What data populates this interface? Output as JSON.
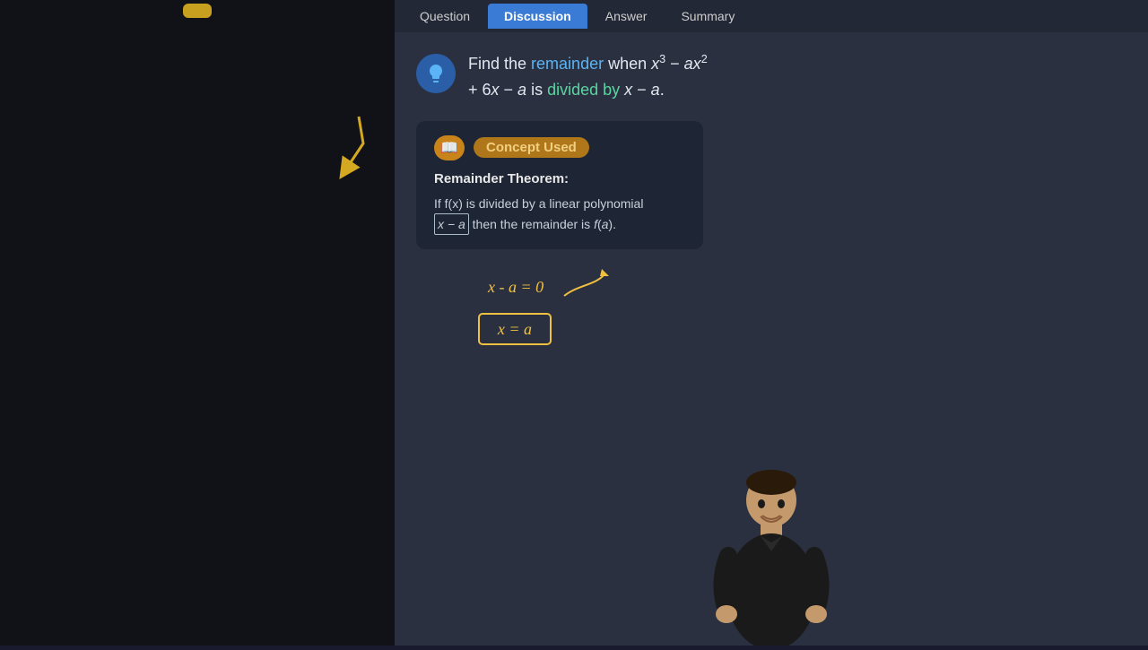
{
  "tabs": [
    {
      "label": "Question",
      "active": false
    },
    {
      "label": "Discussion",
      "active": true
    },
    {
      "label": "Answer",
      "active": false
    },
    {
      "label": "Summary",
      "active": false
    }
  ],
  "question": {
    "text_prefix": "Find the ",
    "highlight1": "remainder",
    "text_middle": " when ",
    "equation1": "x³ − ax²",
    "equation2": "+ 6x − a",
    "text_before_divisor": " is ",
    "highlight2": "divided by",
    "divisor": " x − a."
  },
  "concept": {
    "label": "Concept Used",
    "theorem_title": "Remainder Theorem:",
    "theorem_body_1": "If f(x) is divided by a linear polynomial",
    "theorem_boxed": "x − a",
    "theorem_body_2": "then the remainder is f(a).",
    "annotation_line1": "x - a = 0",
    "annotation_line2": "x = a"
  },
  "icons": {
    "lightbulb": "💡",
    "book": "📖"
  }
}
